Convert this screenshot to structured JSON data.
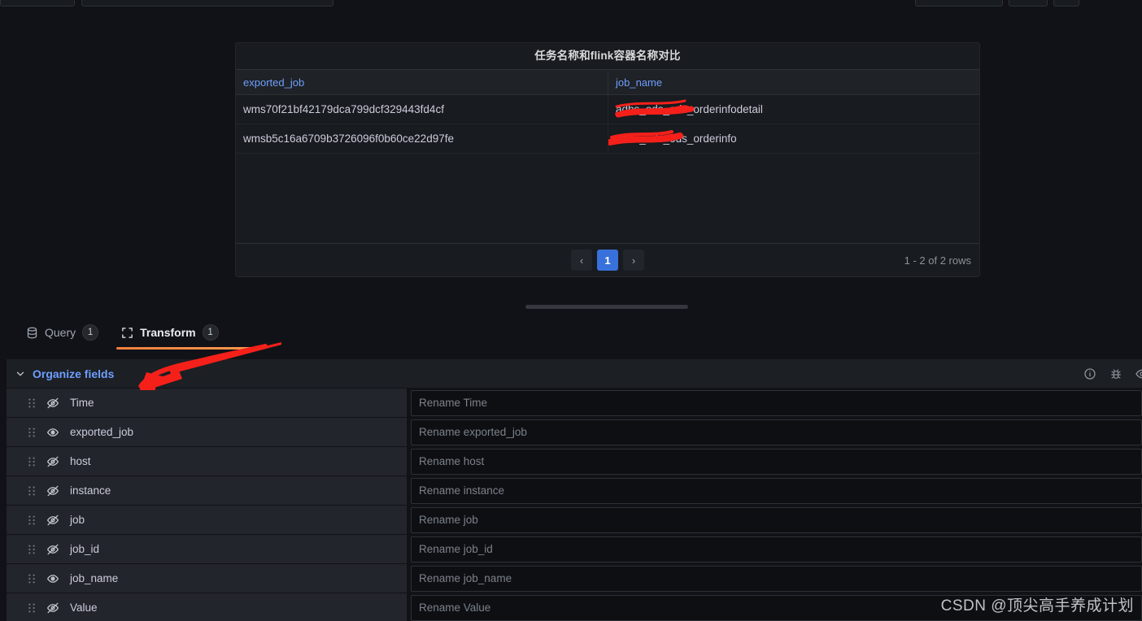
{
  "panel": {
    "title": "任务名称和flink容器名称对比",
    "columns": [
      "exported_job",
      "job_name"
    ],
    "rows": [
      {
        "exported_job": "wms70f21bf42179dca799dcf329443fd4cf",
        "job_name": "adbs_ods_ods_orderinfodetail"
      },
      {
        "exported_job": "wmsb5c16a6709b3726096f0b60ce22d97fe",
        "job_name": "adbs_ods_ods_orderinfo"
      }
    ],
    "pagination": {
      "prev_label": "‹",
      "next_label": "›",
      "current_page": "1",
      "rows_summary": "1 - 2 of 2 rows"
    }
  },
  "tabs": [
    {
      "label": "Query",
      "badge": "1",
      "icon": "database-icon",
      "active": false
    },
    {
      "label": "Transform",
      "badge": "1",
      "icon": "transform-icon",
      "active": true
    }
  ],
  "transform": {
    "title": "Organize fields",
    "collapse_icon": "chevron-down-icon",
    "actions": [
      {
        "icon": "info-icon"
      },
      {
        "icon": "bug-icon"
      },
      {
        "icon": "eye-icon"
      }
    ],
    "fields": [
      {
        "name": "Time",
        "visible": false,
        "rename_placeholder": "Rename Time",
        "rename_value": ""
      },
      {
        "name": "exported_job",
        "visible": true,
        "rename_placeholder": "Rename exported_job",
        "rename_value": ""
      },
      {
        "name": "host",
        "visible": false,
        "rename_placeholder": "Rename host",
        "rename_value": ""
      },
      {
        "name": "instance",
        "visible": false,
        "rename_placeholder": "Rename instance",
        "rename_value": ""
      },
      {
        "name": "job",
        "visible": false,
        "rename_placeholder": "Rename job",
        "rename_value": ""
      },
      {
        "name": "job_id",
        "visible": false,
        "rename_placeholder": "Rename job_id",
        "rename_value": ""
      },
      {
        "name": "job_name",
        "visible": true,
        "rename_placeholder": "Rename job_name",
        "rename_value": ""
      },
      {
        "name": "Value",
        "visible": false,
        "rename_placeholder": "Rename Value",
        "rename_value": ""
      }
    ]
  },
  "watermark": "CSDN @顶尖高手养成计划",
  "colors": {
    "accent_blue": "#6e9fff",
    "tab_underline_orange": "#f2803c",
    "page_active": "#3871dc",
    "annotation_red": "#ff2a22",
    "panel_bg": "#181b1f",
    "app_bg": "#111217"
  }
}
